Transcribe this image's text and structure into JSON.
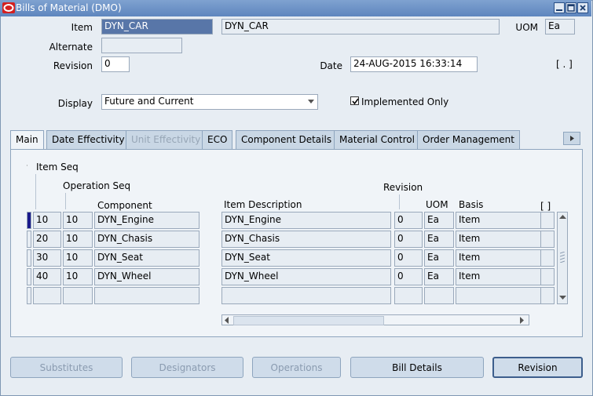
{
  "window": {
    "title": "Bills of Material (DMO)"
  },
  "header": {
    "item_label": "Item",
    "item_value": "DYN_CAR",
    "item_desc": "DYN_CAR",
    "uom_label": "UOM",
    "uom_value": "Ea",
    "alternate_label": "Alternate",
    "alternate_value": "",
    "revision_label": "Revision",
    "revision_value": "0",
    "date_label": "Date",
    "date_value": "24-AUG-2015 16:33:14",
    "bracket_field": "[ . ]",
    "display_label": "Display",
    "display_value": "Future and Current",
    "implemented_label": "Implemented Only",
    "implemented_checked": true
  },
  "tabs": [
    {
      "label": "Main",
      "state": "active"
    },
    {
      "label": "Date Effectivity",
      "state": "normal"
    },
    {
      "label": "Unit Effectivity",
      "state": "disabled"
    },
    {
      "label": "ECO",
      "state": "normal"
    },
    {
      "label": "Component Details",
      "state": "normal"
    },
    {
      "label": "Material Control",
      "state": "normal"
    },
    {
      "label": "Order Management",
      "state": "normal"
    }
  ],
  "grid": {
    "col_item_seq": "Item Seq",
    "col_operation_seq": "Operation Seq",
    "col_component": "Component",
    "col_item_description": "Item Description",
    "col_revision": "Revision",
    "col_uom": "UOM",
    "col_basis": "Basis",
    "col_bracket": "[ ]",
    "rows": [
      {
        "item_seq": "10",
        "op_seq": "10",
        "component": "DYN_Engine",
        "description": "DYN_Engine",
        "revision": "0",
        "uom": "Ea",
        "basis": "Item"
      },
      {
        "item_seq": "20",
        "op_seq": "10",
        "component": "DYN_Chasis",
        "description": "DYN_Chasis",
        "revision": "0",
        "uom": "Ea",
        "basis": "Item"
      },
      {
        "item_seq": "30",
        "op_seq": "10",
        "component": "DYN_Seat",
        "description": "DYN_Seat",
        "revision": "0",
        "uom": "Ea",
        "basis": "Item"
      },
      {
        "item_seq": "40",
        "op_seq": "10",
        "component": "DYN_Wheel",
        "description": "DYN_Wheel",
        "revision": "0",
        "uom": "Ea",
        "basis": "Item"
      },
      {
        "item_seq": "",
        "op_seq": "",
        "component": "",
        "description": "",
        "revision": "",
        "uom": "",
        "basis": ""
      }
    ]
  },
  "buttons": {
    "substitutes": "Substitutes",
    "designators": "Designators",
    "operations": "Operations",
    "bill_details": "Bill Details",
    "revision": "Revision"
  },
  "colors": {
    "title_bar": "#6a8fc5",
    "selected_field": "#5876a8",
    "window_bg": "#e7edf3"
  },
  "icons": {
    "app_logo": "oracle-logo-icon",
    "minimize": "minimize-icon",
    "maximize": "maximize-icon",
    "close": "close-icon"
  }
}
